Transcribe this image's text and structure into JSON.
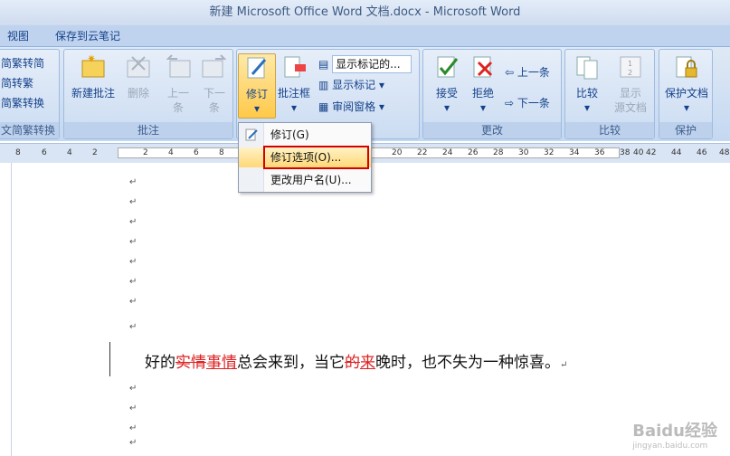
{
  "window": {
    "title": "新建 Microsoft Office Word 文档.docx - Microsoft Word"
  },
  "menu_tabs": [
    "视图",
    "保存到云笔记"
  ],
  "ribbon": {
    "chinese": {
      "items": [
        "简繁转简",
        "简转繁",
        "简繁转换"
      ],
      "title": "文简繁转换"
    },
    "comments": {
      "new": "新建批注",
      "delete": "删除",
      "prev1": "上一",
      "prev2": "条",
      "next1": "下一",
      "next2": "条",
      "title": "批注"
    },
    "tracking": {
      "track": "修订",
      "balloons": "批注框",
      "markup_dropdown": "显示标记的...",
      "show_markup": "显示标记",
      "review_pane": "审阅窗格"
    },
    "changes": {
      "accept": "接受",
      "reject": "拒绝",
      "prev": "上一条",
      "next": "下一条",
      "title": "更改"
    },
    "compare": {
      "compare": "比较",
      "show1": "显示",
      "show2": "源文档",
      "title": "比较"
    },
    "protect": {
      "protect": "保护文档",
      "title": "保护"
    }
  },
  "dropdown_menu": {
    "items": [
      "修订(G)",
      "修订选项(O)...",
      "更改用户名(U)..."
    ]
  },
  "ruler": {
    "ticks": [
      "8",
      "6",
      "4",
      "2",
      "2",
      "4",
      "6",
      "8",
      "20",
      "22",
      "24",
      "26",
      "28",
      "30",
      "32",
      "34",
      "36",
      "38",
      "40",
      "42",
      "44",
      "46",
      "48"
    ]
  },
  "document": {
    "paragraph_mark": "↵",
    "line": {
      "pre": "好的",
      "deleted1": "实情",
      "inserted1": "事情",
      "mid": "总会来到，当它",
      "deleted2": "的",
      "inserted2": "来",
      "post": "晚时，也不失为一种惊喜。",
      "mark": "↵"
    }
  },
  "watermark": {
    "text": "Baidu经验",
    "sub": "jingyan.baidu.com"
  }
}
